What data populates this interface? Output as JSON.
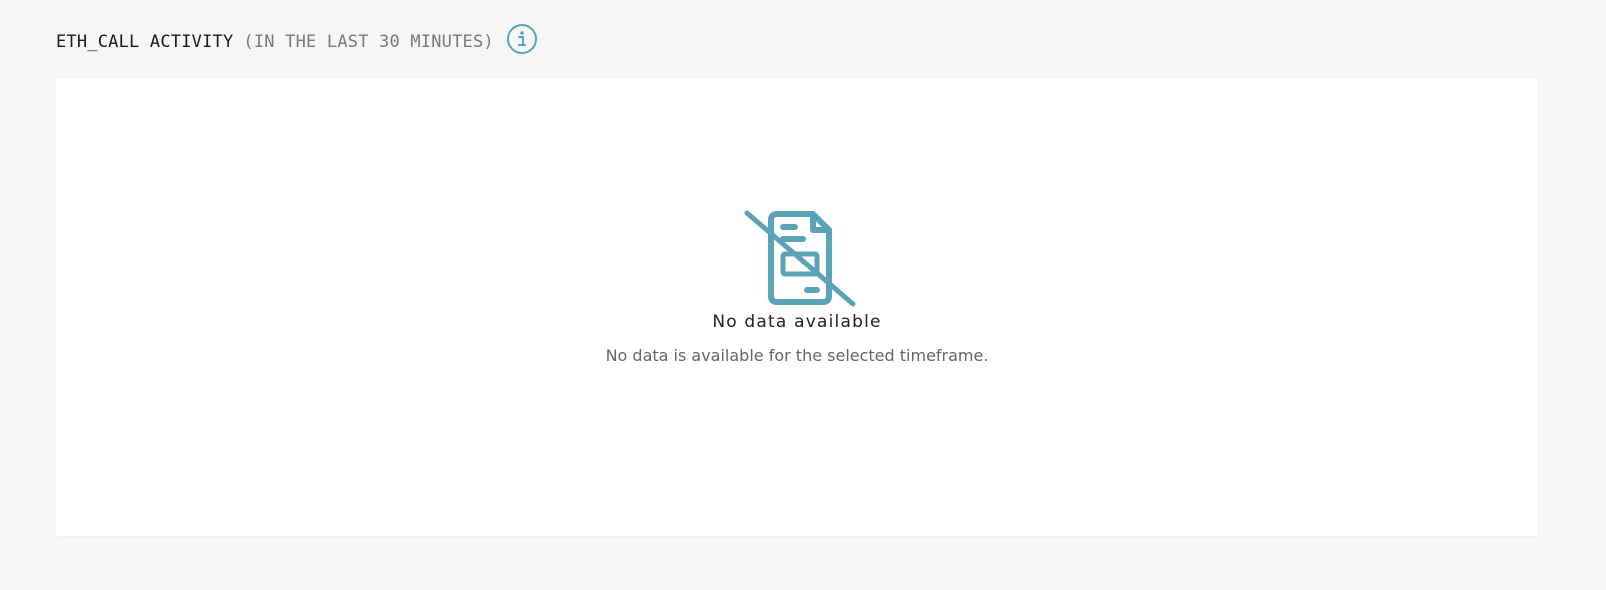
{
  "section": {
    "title": "ETH_CALL ACTIVITY",
    "subtitle": "(IN THE LAST 30 MINUTES)",
    "info_icon": "info-circle-icon"
  },
  "empty_state": {
    "icon": "no-document-icon",
    "title": "No data available",
    "message": "No data is available for the selected timeframe."
  },
  "colors": {
    "background": "#f6f6f6",
    "panel": "#ffffff",
    "accent": "#5ba4b8",
    "title_text": "#1a1a1a",
    "subtitle_text": "#7a7a7a",
    "message_text": "#666666"
  }
}
